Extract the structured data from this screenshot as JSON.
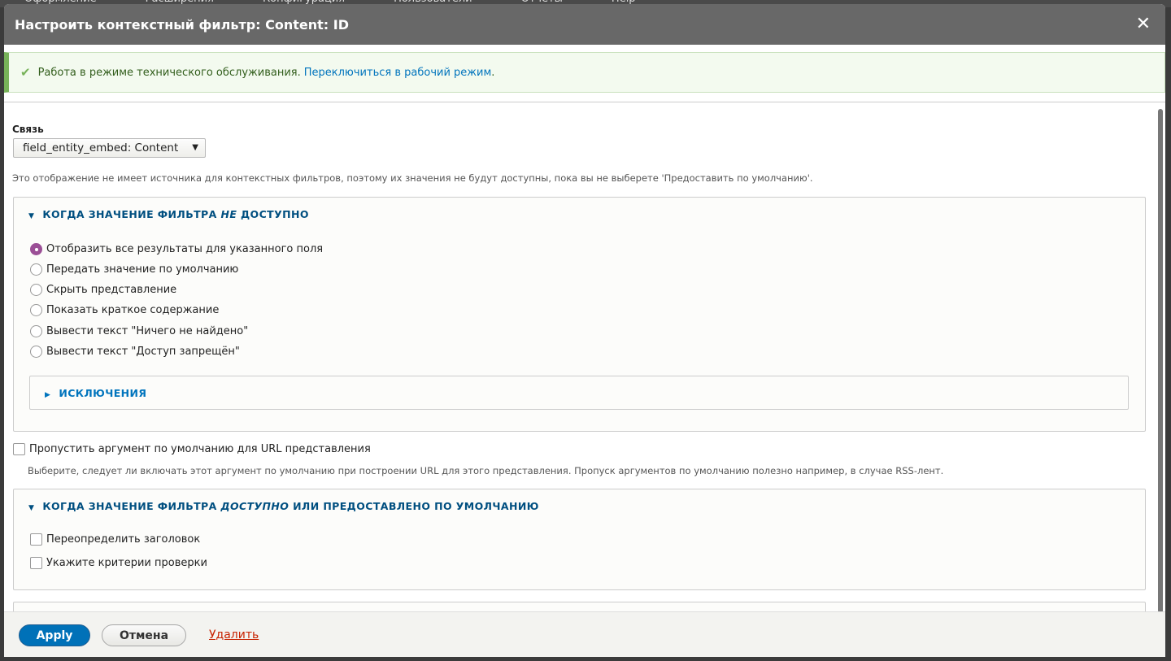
{
  "background_toolbar": [
    "Оформление",
    "Расширения",
    "Конфигурация",
    "Пользователи",
    "Отчеты",
    "Help"
  ],
  "dialog": {
    "title": "Настроить контекстный фильтр: Content: ID",
    "close_icon": "close-icon"
  },
  "message": {
    "text": "Работа в режиме технического обслуживания.",
    "link": "Переключиться в рабочий режим",
    "suffix": ".",
    "status_color": "#77b259"
  },
  "relationship": {
    "label": "Связь",
    "value": "field_entity_embed: Content"
  },
  "relationship_note": "Это отображение не имеет источника для контекстных фильтров, поэтому их значения не будут доступны, пока вы не выберете 'Предоставить по умолчанию'.",
  "not_available": {
    "legend_pre": "КОГДА ЗНАЧЕНИЕ ФИЛЬТРА ",
    "legend_em": "НЕ",
    "legend_post": " ДОСТУПНО",
    "options": [
      "Отобразить все результаты для указанного поля",
      "Передать значение по умолчанию",
      "Скрыть представление",
      "Показать краткое содержание",
      "Вывести текст \"Ничего не найдено\"",
      "Вывести текст \"Доступ запрещён\""
    ],
    "selected": 0,
    "exceptions": "ИСКЛЮЧЕНИЯ"
  },
  "skip_default": {
    "label": "Пропустить аргумент по умолчанию для URL представления",
    "checked": false,
    "description": "Выберите, следует ли включать этот аргумент по умолчанию при построении URL для этого представления. Пропуск аргументов по умолчанию полезно например, в случае RSS-лент."
  },
  "available": {
    "legend_pre": "КОГДА ЗНАЧЕНИЕ ФИЛЬТРА ",
    "legend_em": "ДОСТУПНО",
    "legend_post": " ИЛИ ПРЕДОСТАВЛЕНО ПО УМОЛЧАНИЮ",
    "checkboxes": [
      {
        "label": "Переопределить заголовок",
        "checked": false
      },
      {
        "label": "Укажите критерии проверки",
        "checked": false
      }
    ]
  },
  "footer": {
    "apply": "Apply",
    "cancel": "Отмена",
    "delete": "Удалить"
  }
}
